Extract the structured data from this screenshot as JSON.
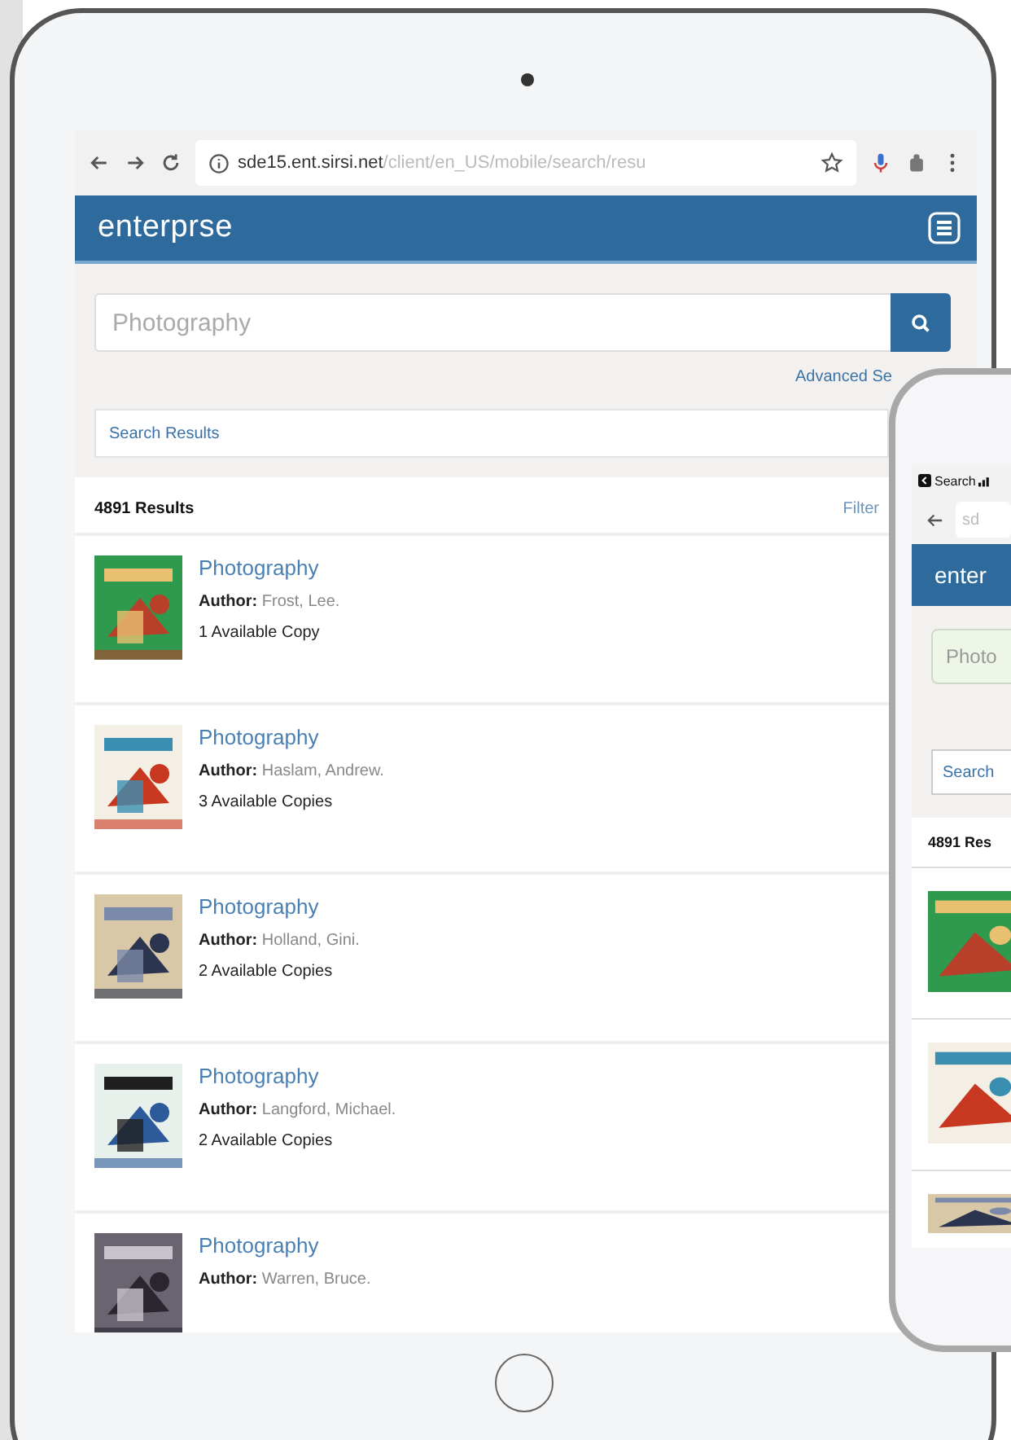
{
  "browser": {
    "url_host": "sde15.ent.sirsi.net",
    "url_path": "/client/en_US/mobile/search/resu"
  },
  "header": {
    "logo": "enterprse"
  },
  "search": {
    "placeholder": "Photography",
    "advanced_link": "Advanced Se",
    "results_field": "Search Results"
  },
  "results_header": {
    "count": "4891 Results",
    "filter": "Filter"
  },
  "results": [
    {
      "title": "Photography",
      "author_label": "Author:",
      "author": "Frost, Lee.",
      "availability": "1 Available Copy"
    },
    {
      "title": "Photography",
      "author_label": "Author:",
      "author": "Haslam, Andrew.",
      "availability": "3 Available Copies"
    },
    {
      "title": "Photography",
      "author_label": "Author:",
      "author": "Holland, Gini.",
      "availability": "2 Available Copies"
    },
    {
      "title": "Photography",
      "author_label": "Author:",
      "author": "Langford, Michael.",
      "availability": "2 Available Copies"
    },
    {
      "title": "Photography",
      "author_label": "Author:",
      "author": "Warren, Bruce."
    }
  ],
  "phone": {
    "status_back": "Search",
    "url": "sd",
    "logo": "enter",
    "placeholder": "Photo",
    "results_field": "Search",
    "count": "4891 Res"
  }
}
